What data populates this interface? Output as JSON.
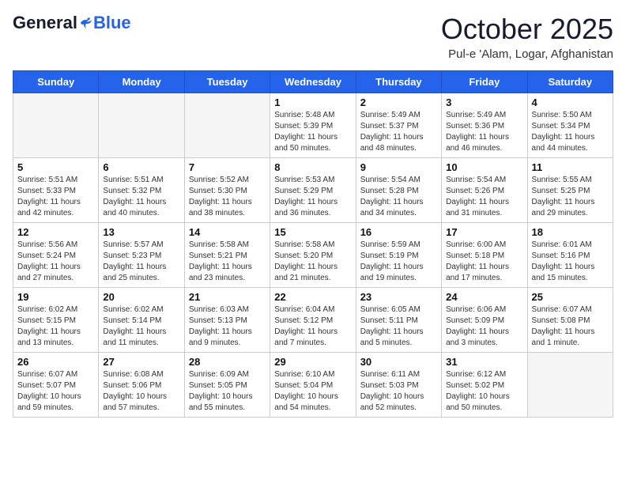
{
  "header": {
    "logo_general": "General",
    "logo_blue": "Blue",
    "month": "October 2025",
    "location": "Pul-e 'Alam, Logar, Afghanistan"
  },
  "weekdays": [
    "Sunday",
    "Monday",
    "Tuesday",
    "Wednesday",
    "Thursday",
    "Friday",
    "Saturday"
  ],
  "weeks": [
    [
      {
        "day": "",
        "info": ""
      },
      {
        "day": "",
        "info": ""
      },
      {
        "day": "",
        "info": ""
      },
      {
        "day": "1",
        "info": "Sunrise: 5:48 AM\nSunset: 5:39 PM\nDaylight: 11 hours\nand 50 minutes."
      },
      {
        "day": "2",
        "info": "Sunrise: 5:49 AM\nSunset: 5:37 PM\nDaylight: 11 hours\nand 48 minutes."
      },
      {
        "day": "3",
        "info": "Sunrise: 5:49 AM\nSunset: 5:36 PM\nDaylight: 11 hours\nand 46 minutes."
      },
      {
        "day": "4",
        "info": "Sunrise: 5:50 AM\nSunset: 5:34 PM\nDaylight: 11 hours\nand 44 minutes."
      }
    ],
    [
      {
        "day": "5",
        "info": "Sunrise: 5:51 AM\nSunset: 5:33 PM\nDaylight: 11 hours\nand 42 minutes."
      },
      {
        "day": "6",
        "info": "Sunrise: 5:51 AM\nSunset: 5:32 PM\nDaylight: 11 hours\nand 40 minutes."
      },
      {
        "day": "7",
        "info": "Sunrise: 5:52 AM\nSunset: 5:30 PM\nDaylight: 11 hours\nand 38 minutes."
      },
      {
        "day": "8",
        "info": "Sunrise: 5:53 AM\nSunset: 5:29 PM\nDaylight: 11 hours\nand 36 minutes."
      },
      {
        "day": "9",
        "info": "Sunrise: 5:54 AM\nSunset: 5:28 PM\nDaylight: 11 hours\nand 34 minutes."
      },
      {
        "day": "10",
        "info": "Sunrise: 5:54 AM\nSunset: 5:26 PM\nDaylight: 11 hours\nand 31 minutes."
      },
      {
        "day": "11",
        "info": "Sunrise: 5:55 AM\nSunset: 5:25 PM\nDaylight: 11 hours\nand 29 minutes."
      }
    ],
    [
      {
        "day": "12",
        "info": "Sunrise: 5:56 AM\nSunset: 5:24 PM\nDaylight: 11 hours\nand 27 minutes."
      },
      {
        "day": "13",
        "info": "Sunrise: 5:57 AM\nSunset: 5:23 PM\nDaylight: 11 hours\nand 25 minutes."
      },
      {
        "day": "14",
        "info": "Sunrise: 5:58 AM\nSunset: 5:21 PM\nDaylight: 11 hours\nand 23 minutes."
      },
      {
        "day": "15",
        "info": "Sunrise: 5:58 AM\nSunset: 5:20 PM\nDaylight: 11 hours\nand 21 minutes."
      },
      {
        "day": "16",
        "info": "Sunrise: 5:59 AM\nSunset: 5:19 PM\nDaylight: 11 hours\nand 19 minutes."
      },
      {
        "day": "17",
        "info": "Sunrise: 6:00 AM\nSunset: 5:18 PM\nDaylight: 11 hours\nand 17 minutes."
      },
      {
        "day": "18",
        "info": "Sunrise: 6:01 AM\nSunset: 5:16 PM\nDaylight: 11 hours\nand 15 minutes."
      }
    ],
    [
      {
        "day": "19",
        "info": "Sunrise: 6:02 AM\nSunset: 5:15 PM\nDaylight: 11 hours\nand 13 minutes."
      },
      {
        "day": "20",
        "info": "Sunrise: 6:02 AM\nSunset: 5:14 PM\nDaylight: 11 hours\nand 11 minutes."
      },
      {
        "day": "21",
        "info": "Sunrise: 6:03 AM\nSunset: 5:13 PM\nDaylight: 11 hours\nand 9 minutes."
      },
      {
        "day": "22",
        "info": "Sunrise: 6:04 AM\nSunset: 5:12 PM\nDaylight: 11 hours\nand 7 minutes."
      },
      {
        "day": "23",
        "info": "Sunrise: 6:05 AM\nSunset: 5:11 PM\nDaylight: 11 hours\nand 5 minutes."
      },
      {
        "day": "24",
        "info": "Sunrise: 6:06 AM\nSunset: 5:09 PM\nDaylight: 11 hours\nand 3 minutes."
      },
      {
        "day": "25",
        "info": "Sunrise: 6:07 AM\nSunset: 5:08 PM\nDaylight: 11 hours\nand 1 minute."
      }
    ],
    [
      {
        "day": "26",
        "info": "Sunrise: 6:07 AM\nSunset: 5:07 PM\nDaylight: 10 hours\nand 59 minutes."
      },
      {
        "day": "27",
        "info": "Sunrise: 6:08 AM\nSunset: 5:06 PM\nDaylight: 10 hours\nand 57 minutes."
      },
      {
        "day": "28",
        "info": "Sunrise: 6:09 AM\nSunset: 5:05 PM\nDaylight: 10 hours\nand 55 minutes."
      },
      {
        "day": "29",
        "info": "Sunrise: 6:10 AM\nSunset: 5:04 PM\nDaylight: 10 hours\nand 54 minutes."
      },
      {
        "day": "30",
        "info": "Sunrise: 6:11 AM\nSunset: 5:03 PM\nDaylight: 10 hours\nand 52 minutes."
      },
      {
        "day": "31",
        "info": "Sunrise: 6:12 AM\nSunset: 5:02 PM\nDaylight: 10 hours\nand 50 minutes."
      },
      {
        "day": "",
        "info": ""
      }
    ]
  ]
}
